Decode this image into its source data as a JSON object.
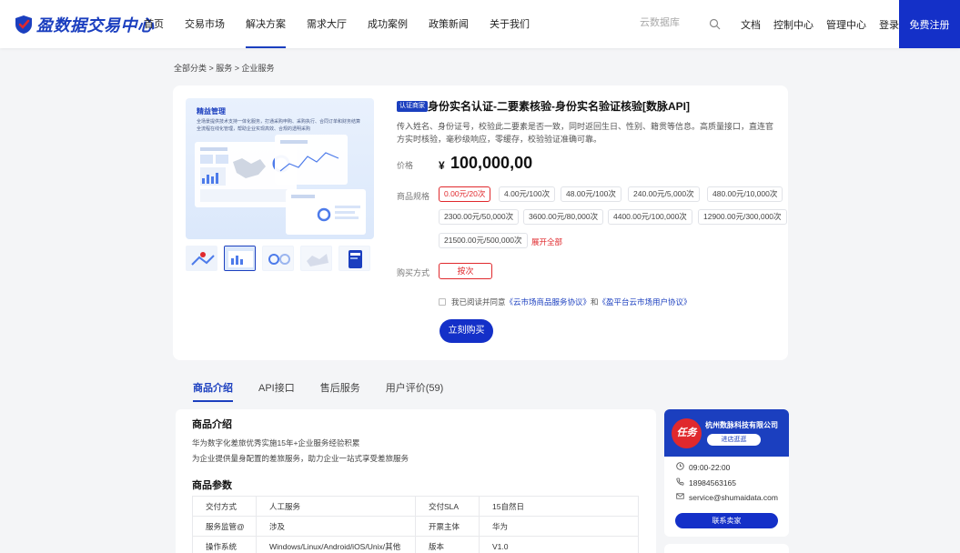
{
  "nav": {
    "logo_text": "盈数据交易中心",
    "items": [
      {
        "label": "首页",
        "active": false
      },
      {
        "label": "交易市场",
        "active": false
      },
      {
        "label": "解决方案",
        "active": true
      },
      {
        "label": "需求大厅",
        "active": false
      },
      {
        "label": "成功案例",
        "active": false
      },
      {
        "label": "政策新闻",
        "active": false
      },
      {
        "label": "关于我们",
        "active": false
      }
    ],
    "search_placeholder": "云数据库",
    "links": [
      "文档",
      "控制中心",
      "管理中心",
      "登录"
    ],
    "register": "免费注册",
    "accent": "#1430c8"
  },
  "breadcrumb": "全部分类 > 服务 > 企业服务",
  "product": {
    "image_title": "精益管理",
    "image_desc": "全场景提供技术支持一体化服务，打通采购申购、采购执行、合同订单和财务结算全流程在线化管理，帮助企业实现高效、合规的透明采购",
    "badge": "认证商家",
    "title": "身份实名认证-二要素核验-身份实名验证核验[数脉API]",
    "description": "传入姓名、身份证号，校验此二要素是否一致，同时返回生日、性别、籍贯等信息。高质量接口，直连官方实时核验，毫秒级响应，零缓存，校验验证准确可靠。",
    "price_label": "价格",
    "price_symbol": "¥",
    "price": "100,000,00",
    "spec_label": "商品规格",
    "specs": [
      "0.00元/20次",
      "4.00元/100次",
      "48.00元/100次",
      "240.00元/5,000次",
      "480.00元/10,000次",
      "2300.00元/50,000次",
      "3600.00元/80,000次",
      "4400.00元/100,000次",
      "12900.00元/300,000次",
      "21500.00元/500,000次"
    ],
    "selected_spec_index": 0,
    "expand_label": "展开全部",
    "buy_mode_label": "购买方式",
    "buy_mode": "按次",
    "agree_prefix": "我已阅读并同意",
    "agree_link1": "《云市场商品服务协议》",
    "agree_and": "和",
    "agree_link2": "《盈平台云市场用户协议》",
    "buy_button": "立刻购买"
  },
  "tabs": [
    {
      "label": "商品介绍",
      "active": true
    },
    {
      "label": "API接口",
      "active": false
    },
    {
      "label": "售后服务",
      "active": false
    },
    {
      "label": "用户评价(59)",
      "active": false
    }
  ],
  "detail": {
    "intro_title": "商品介绍",
    "intro_lines": [
      "华为数字化差旅优秀实施15年+企业服务经验积累",
      "为企业提供量身配置的差旅服务，助力企业一站式享受差旅服务"
    ],
    "params_title": "商品参数",
    "params": [
      [
        "交付方式",
        "人工服务",
        "交付SLA",
        "15自然日"
      ],
      [
        "服务监管@",
        "涉及",
        "开票主体",
        "华为"
      ],
      [
        "操作系统",
        "Windows/Linux/Android/iOS/Unix/其他",
        "版本",
        "V1.0"
      ]
    ]
  },
  "seller": {
    "logo_text": "任务",
    "name": "杭州数脉科技有限公司",
    "shop_button": "进店逛逛",
    "hours": "09:00-22:00",
    "phone": "18984563165",
    "email": "service@shumaidata.com",
    "contact_button": "联系卖家"
  }
}
